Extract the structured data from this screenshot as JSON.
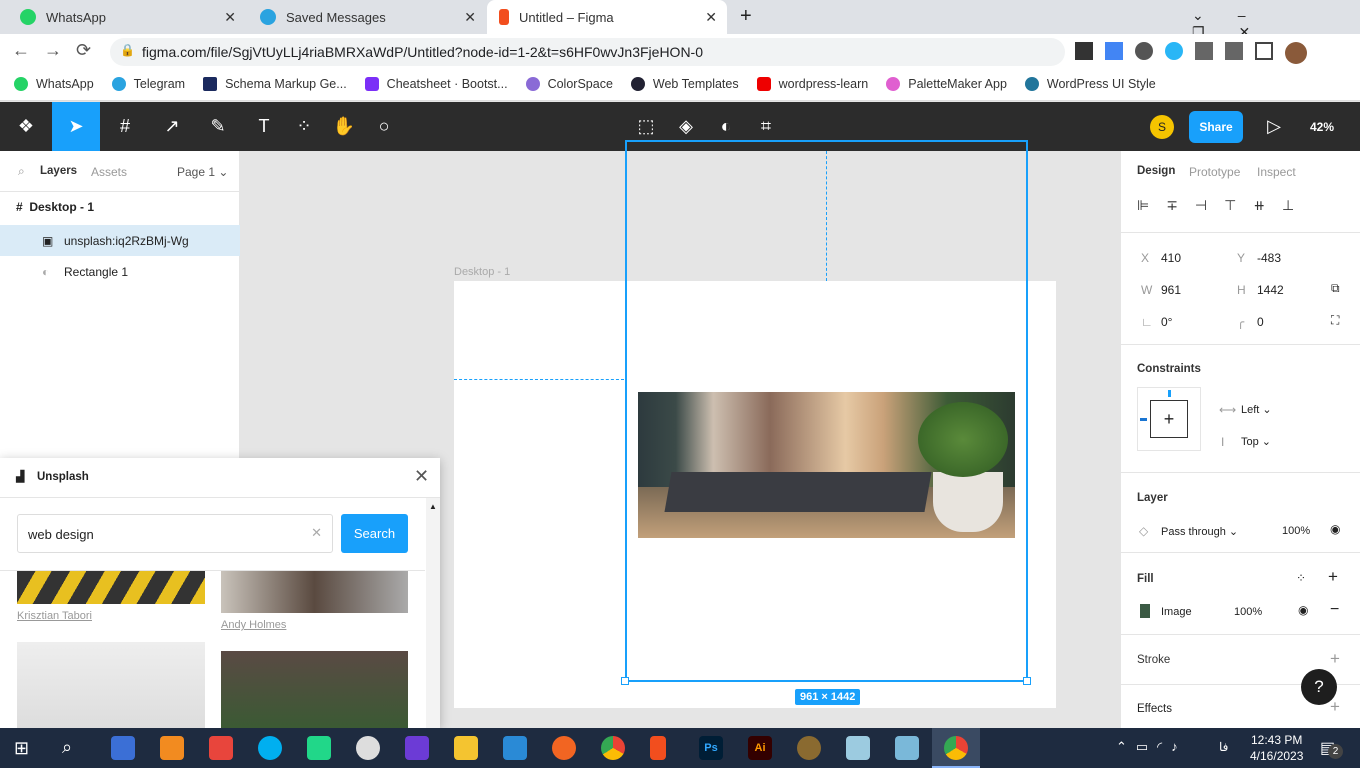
{
  "browser": {
    "tabs": [
      {
        "label": "WhatsApp",
        "color": "#25d366"
      },
      {
        "label": "Saved Messages",
        "color": "#2aa3e0"
      },
      {
        "label": "Untitled – Figma",
        "color": "#f24e1e"
      }
    ],
    "url": "figma.com/file/SgjVtUyLLj4riaBMRXaWdP/Untitled?node-id=1-2&t=s6HF0wvJn3FjeHON-0",
    "bookmarks": [
      {
        "label": "WhatsApp",
        "color": "#25d366"
      },
      {
        "label": "Telegram",
        "color": "#2aa3e0"
      },
      {
        "label": "Schema Markup Ge...",
        "color": "#1b2a5e"
      },
      {
        "label": "Cheatsheet · Bootst...",
        "color": "#7b2ff7"
      },
      {
        "label": "ColorSpace",
        "color": "#8a6ad6"
      },
      {
        "label": "Web Templates",
        "color": "#223"
      },
      {
        "label": "wordpress-learn",
        "color": "#e00"
      },
      {
        "label": "PaletteMaker App",
        "color": "#e05fd0"
      },
      {
        "label": "WordPress UI Style",
        "color": "#21759b"
      }
    ]
  },
  "figma": {
    "avatar": "S",
    "share": "Share",
    "zoom": "42%",
    "accent": "#18a0fb",
    "left": {
      "tabs": [
        "Layers",
        "Assets"
      ],
      "page": "Page 1",
      "layers": [
        "Desktop - 1",
        "unsplash:iq2RzBMj-Wg",
        "Rectangle 1"
      ]
    },
    "canvas": {
      "frame_label": "Desktop - 1",
      "size_badge": "961 × 1442"
    },
    "plugin": {
      "title": "Unsplash",
      "search_value": "web design",
      "search_button": "Search",
      "credits": [
        "Krisztian Tabori",
        "Andy Holmes"
      ]
    },
    "right": {
      "tabs": [
        "Design",
        "Prototype",
        "Inspect"
      ],
      "x": "410",
      "y": "-483",
      "w": "961",
      "h": "1442",
      "rotation": "0°",
      "radius": "0",
      "constraints_title": "Constraints",
      "h_constraint": "Left",
      "v_constraint": "Top",
      "layer_title": "Layer",
      "blend": "Pass through",
      "opacity": "100%",
      "fill_title": "Fill",
      "fill_type": "Image",
      "fill_opacity": "100%",
      "stroke_title": "Stroke",
      "effects_title": "Effects",
      "help": "?"
    }
  },
  "taskbar": {
    "time": "12:43 PM",
    "date": "4/16/2023",
    "lang": "فا",
    "notifications": "2"
  }
}
